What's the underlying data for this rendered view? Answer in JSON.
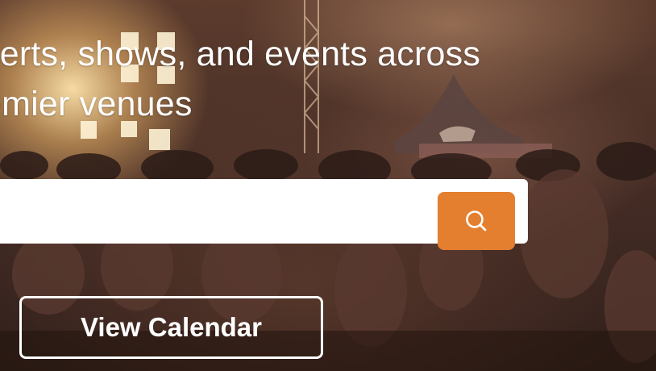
{
  "hero": {
    "tagline_line1": "certs, shows, and events across",
    "tagline_line2": "emier venues"
  },
  "search": {
    "placeholder": "",
    "value": "",
    "button_icon": "search-icon"
  },
  "actions": {
    "calendar_label": "View Calendar"
  },
  "colors": {
    "accent": "#e37f2e",
    "text": "#ffffff",
    "search_bg": "#ffffff"
  }
}
